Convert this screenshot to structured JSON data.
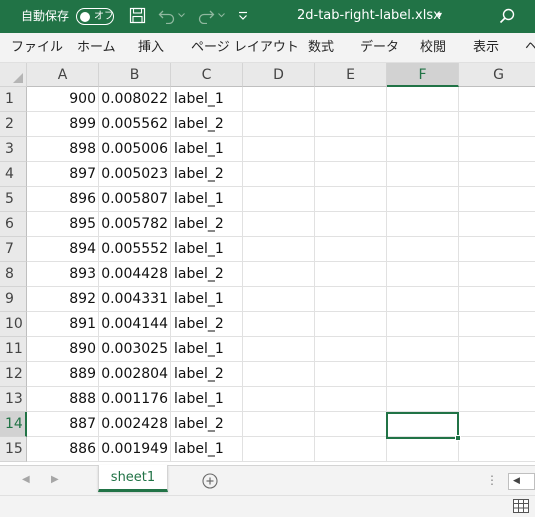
{
  "titlebar": {
    "autosave_label": "自動保存",
    "autosave_state": "オフ",
    "filename": "2d-tab-right-label.xlsx",
    "filename_caret": "▾",
    "colors": {
      "background": "#217346",
      "text": "#ffffff"
    },
    "icons": [
      "save-icon",
      "undo-icon",
      "redo-icon",
      "customize-qat-icon",
      "search-icon"
    ]
  },
  "ribbon": {
    "tabs": [
      "ファイル",
      "ホーム",
      "挿入",
      "ページ レイアウト",
      "数式",
      "データ",
      "校閲",
      "表示",
      "ヘ"
    ]
  },
  "sheet": {
    "columns": [
      "A",
      "B",
      "C",
      "D",
      "E",
      "F",
      "G"
    ],
    "active_column": "F",
    "active_row": "14",
    "rows": [
      {
        "n": "1",
        "a": "900",
        "b": "0.008022",
        "c": "label_1"
      },
      {
        "n": "2",
        "a": "899",
        "b": "0.005562",
        "c": "label_2"
      },
      {
        "n": "3",
        "a": "898",
        "b": "0.005006",
        "c": "label_1"
      },
      {
        "n": "4",
        "a": "897",
        "b": "0.005023",
        "c": "label_2"
      },
      {
        "n": "5",
        "a": "896",
        "b": "0.005807",
        "c": "label_1"
      },
      {
        "n": "6",
        "a": "895",
        "b": "0.005782",
        "c": "label_2"
      },
      {
        "n": "7",
        "a": "894",
        "b": "0.005552",
        "c": "label_1"
      },
      {
        "n": "8",
        "a": "893",
        "b": "0.004428",
        "c": "label_2"
      },
      {
        "n": "9",
        "a": "892",
        "b": "0.004331",
        "c": "label_1"
      },
      {
        "n": "10",
        "a": "891",
        "b": "0.004144",
        "c": "label_2"
      },
      {
        "n": "11",
        "a": "890",
        "b": "0.003025",
        "c": "label_1"
      },
      {
        "n": "12",
        "a": "889",
        "b": "0.002804",
        "c": "label_2"
      },
      {
        "n": "13",
        "a": "888",
        "b": "0.001176",
        "c": "label_1"
      },
      {
        "n": "14",
        "a": "887",
        "b": "0.002428",
        "c": "label_2"
      },
      {
        "n": "15",
        "a": "886",
        "b": "0.001949",
        "c": "label_1"
      }
    ]
  },
  "sheetbar": {
    "tab_label": "sheet1",
    "add_sheet_symbol": "⊕",
    "nav_prev": "◀",
    "nav_next": "▶",
    "more_symbol": "⋮",
    "scroll_left": "◀"
  },
  "statusbar": {
    "icons": [
      "normal-view-icon"
    ]
  }
}
